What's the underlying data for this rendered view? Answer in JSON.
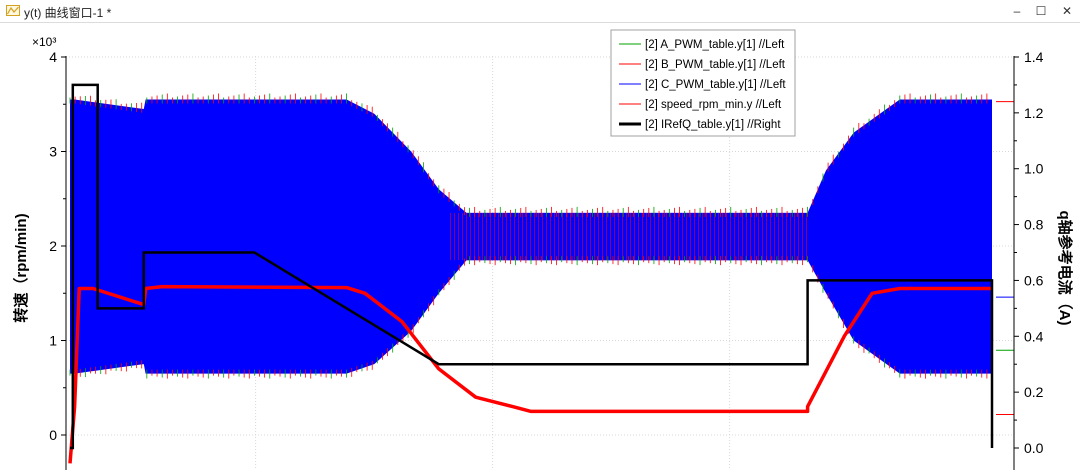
{
  "window": {
    "title": "y(t) 曲线窗口-1 *",
    "minimize_glyph": "–",
    "maximize_glyph": "☐",
    "close_glyph": "✕"
  },
  "chart_data": {
    "type": "line",
    "left_axis": {
      "label": "转速（rpm/min)",
      "multiplier": "×10³",
      "range": [
        -0.5,
        4.0
      ],
      "ticks": [
        0,
        1,
        2,
        3,
        4
      ],
      "tick_labels": [
        "0",
        "1",
        "2",
        "3",
        "4"
      ]
    },
    "right_axis": {
      "label": "q轴参考电流（A)",
      "range": [
        -0.05,
        1.4
      ],
      "ticks": [
        0.0,
        0.2,
        0.4,
        0.6,
        0.8,
        1.0,
        1.2,
        1.4
      ],
      "tick_labels": [
        "0.0",
        "0.2",
        "0.4",
        "0.6",
        "0.8",
        "1.0",
        "1.2",
        "1.4"
      ]
    },
    "x_range": [
      0,
      1
    ],
    "grid": true,
    "legend_position": "top-center",
    "colors": {
      "pwm_a": "#00a000",
      "pwm_b": "#ff0000",
      "pwm_c": "#0000ff",
      "speed": "#ff0000",
      "iref": "#000000"
    },
    "series": [
      {
        "name": "[2] A_PWM_table.y[1] //Left",
        "key": "pwm_a",
        "axis": "left"
      },
      {
        "name": "[2] B_PWM_table.y[1] //Left",
        "key": "pwm_b",
        "axis": "left"
      },
      {
        "name": "[2] C_PWM_table.y[1] //Left",
        "key": "pwm_c",
        "axis": "left"
      },
      {
        "name": "[2] speed_rpm_min.y //Left",
        "key": "speed",
        "axis": "left",
        "x": [
          0.0,
          0.005,
          0.01,
          0.025,
          0.08,
          0.082,
          0.1,
          0.3,
          0.32,
          0.36,
          0.4,
          0.44,
          0.48,
          0.5,
          0.6,
          0.8,
          0.8,
          0.84,
          0.87,
          0.9,
          1.0
        ],
        "y": [
          -0.3,
          0.3,
          1.55,
          1.55,
          1.38,
          1.55,
          1.57,
          1.56,
          1.5,
          1.2,
          0.7,
          0.4,
          0.3,
          0.25,
          0.25,
          0.25,
          0.3,
          1.05,
          1.5,
          1.55,
          1.55
        ]
      },
      {
        "name": "[2] IRefQ_table.y[1] //Right",
        "key": "iref",
        "axis": "right",
        "x": [
          0.0,
          0.003,
          0.003,
          0.03,
          0.03,
          0.08,
          0.08,
          0.2,
          0.4,
          0.8,
          0.8,
          1.0,
          1.0
        ],
        "y": [
          0.0,
          0.0,
          1.3,
          1.3,
          0.5,
          0.5,
          0.7,
          0.7,
          0.3,
          0.3,
          0.6,
          0.6,
          0.0
        ]
      }
    ],
    "pwm_envelope": {
      "x": [
        0.0,
        0.005,
        0.08,
        0.082,
        0.3,
        0.33,
        0.37,
        0.4,
        0.43,
        0.8,
        0.82,
        0.85,
        0.9,
        1.0
      ],
      "upper": [
        3.55,
        3.55,
        3.45,
        3.55,
        3.55,
        3.4,
        3.0,
        2.6,
        2.35,
        2.35,
        2.8,
        3.2,
        3.55,
        3.55
      ],
      "lower": [
        0.65,
        0.65,
        0.75,
        0.65,
        0.65,
        0.75,
        1.1,
        1.5,
        1.85,
        1.85,
        1.5,
        1.0,
        0.65,
        0.65
      ]
    }
  }
}
